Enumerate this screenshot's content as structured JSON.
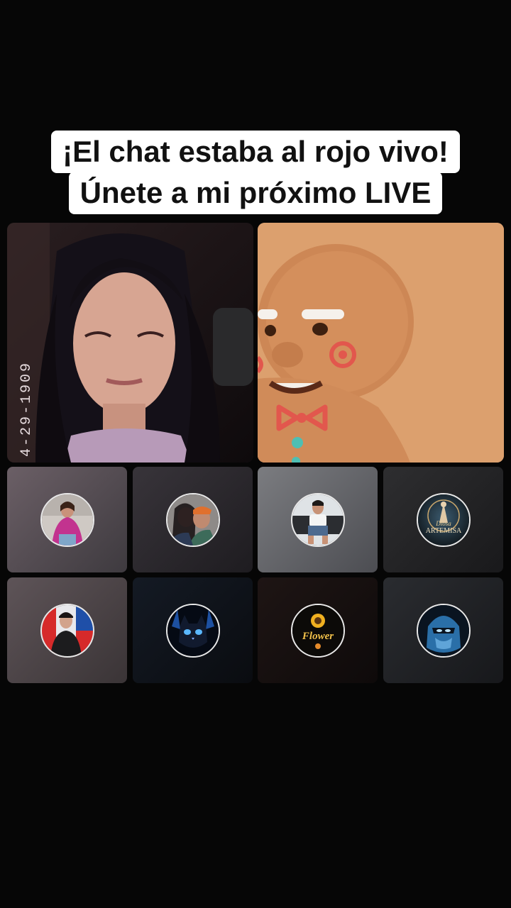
{
  "caption": {
    "line1": "¡El chat estaba al rojo vivo!",
    "line2": "Únete a mi próximo LIVE"
  },
  "host_video": {
    "timestamp": "4-29-1909"
  },
  "guests": [
    {
      "avatar": "woman-pink-shawl-avatar"
    },
    {
      "avatar": "couple-avatar"
    },
    {
      "avatar": "man-truck-avatar"
    },
    {
      "avatar": "diosa-artemisa-avatar",
      "text_line1": "Diosa",
      "text_line2": "ARTEMISA"
    },
    {
      "avatar": "man-chile-flag-avatar"
    },
    {
      "avatar": "blue-cat-avatar"
    },
    {
      "avatar": "sunflower-flower-avatar",
      "text": "Flower"
    },
    {
      "avatar": "blue-ninja-mask-avatar"
    }
  ],
  "colors": {
    "background": "#060606",
    "caption_bg": "#ffffff",
    "gingerbread": "#dca06e"
  }
}
